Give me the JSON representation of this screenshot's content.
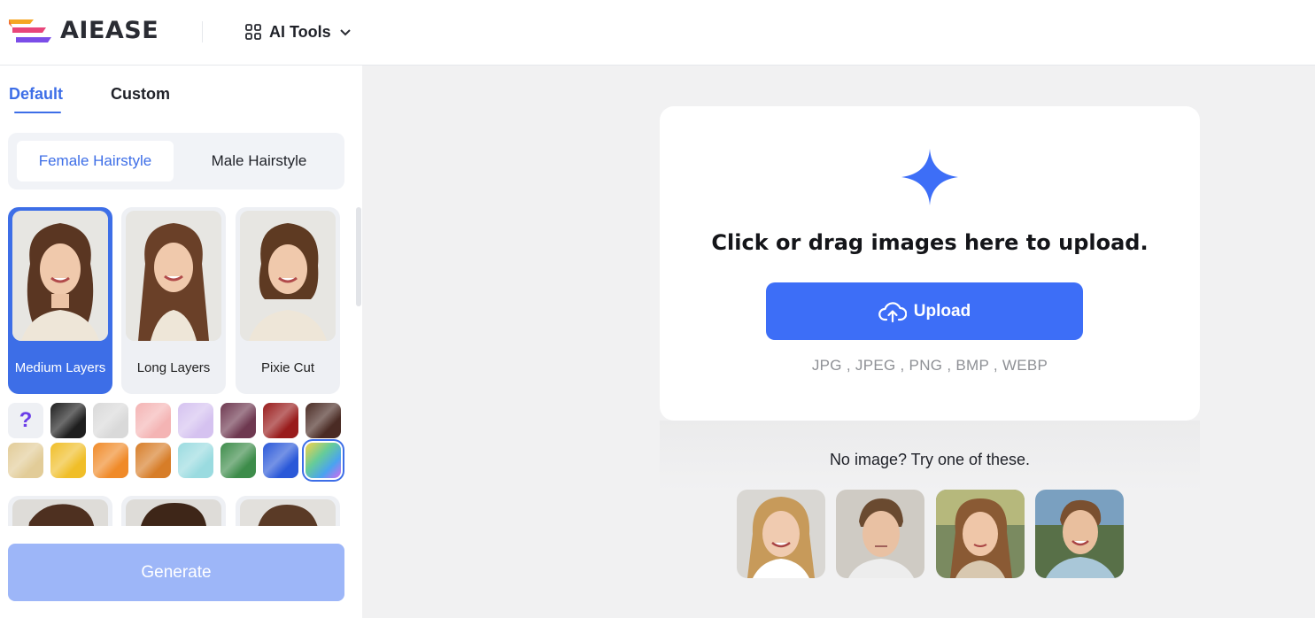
{
  "header": {
    "logo_text": "AIEASE",
    "tools_label": "AI Tools"
  },
  "sidebar": {
    "tabs": [
      {
        "label": "Default",
        "active": true
      },
      {
        "label": "Custom",
        "active": false
      }
    ],
    "segments": [
      {
        "label": "Female Hairstyle",
        "active": true
      },
      {
        "label": "Male Hairstyle",
        "active": false
      }
    ],
    "styles": [
      {
        "label": "Medium Layers",
        "selected": true
      },
      {
        "label": "Long Layers",
        "selected": false
      },
      {
        "label": "Pixie Cut",
        "selected": false
      }
    ],
    "colors": [
      {
        "name": "random",
        "value": "#eef0f4",
        "glyph": "?"
      },
      {
        "name": "black",
        "value": "#1e1e1e"
      },
      {
        "name": "silver",
        "value": "#d9d9d9"
      },
      {
        "name": "pink",
        "value": "#f4b4b4"
      },
      {
        "name": "lavender",
        "value": "#d5c2f0"
      },
      {
        "name": "plum",
        "value": "#6e3850"
      },
      {
        "name": "red",
        "value": "#991c1c"
      },
      {
        "name": "dark-brown",
        "value": "#4a2b24"
      },
      {
        "name": "blonde",
        "value": "#e2cc98"
      },
      {
        "name": "gold",
        "value": "#f0be28"
      },
      {
        "name": "orange",
        "value": "#f08a28"
      },
      {
        "name": "copper",
        "value": "#d77d28"
      },
      {
        "name": "aqua",
        "value": "#9adbe0"
      },
      {
        "name": "green",
        "value": "#3d8c4a"
      },
      {
        "name": "blue",
        "value": "#2a58d8"
      },
      {
        "name": "rainbow",
        "value": "#66cc99",
        "selected": true
      }
    ],
    "generate_label": "Generate"
  },
  "main": {
    "upload_title": "Click or drag images here to upload.",
    "upload_label": "Upload",
    "formats": "JPG , JPEG , PNG , BMP , WEBP",
    "samples_label": "No image? Try one of these."
  },
  "colors": {
    "accent": "#3d6ee7",
    "button_blue": "#3d6ef7",
    "generate_disabled": "#9db6f8",
    "main_bg": "#f1f1f2"
  }
}
